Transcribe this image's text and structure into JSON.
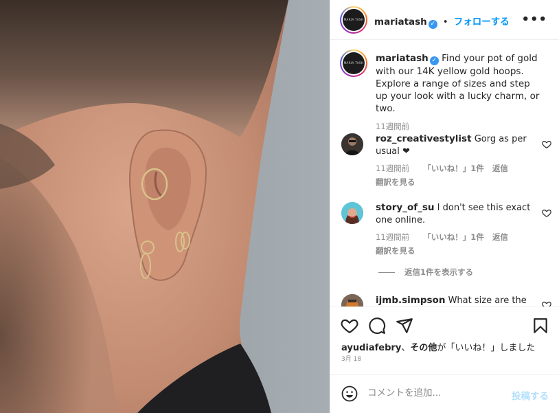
{
  "post": {
    "username": "mariatash",
    "verified": true,
    "follow_label": "フォローする",
    "separator": "•",
    "logo_text": "MARIA TASH",
    "caption": "Find your pot of gold with our 14K yellow gold hoops. Explore a range of sizes and step up your look with a lucky charm, or two.",
    "caption_time": "11週間前"
  },
  "comments": [
    {
      "username": "roz_creativestylist",
      "text": "Gorg as per usual ❤",
      "time": "11週間前",
      "likes": "「いいね！」1件",
      "reply_label": "返信",
      "translate_label": "翻訳を見る"
    },
    {
      "username": "story_of_su",
      "text": "I don't see this exact one online.",
      "time": "11週間前",
      "likes": "「いいね！」1件",
      "reply_label": "返信",
      "translate_label": "翻訳を見る",
      "view_replies": "返信1件を表示する"
    },
    {
      "username": "ijmb.simpson",
      "text": "What size are the"
    }
  ],
  "likes_line": {
    "user": "ayudiafebry",
    "sep": "、",
    "others": "その他",
    "suffix": "が「いいね！」しました"
  },
  "date": "3月 18",
  "add_comment": {
    "placeholder": "コメントを追加...",
    "post_label": "投稿する"
  },
  "colors": {
    "accent": "#0095f6",
    "verified": "#3897f0",
    "post_disabled": "#b2dffc",
    "muted": "#8e8e8e"
  },
  "icons": [
    "more-icon",
    "heart-icon",
    "comment-icon",
    "share-icon",
    "save-icon",
    "emoji-icon",
    "verified-icon"
  ]
}
